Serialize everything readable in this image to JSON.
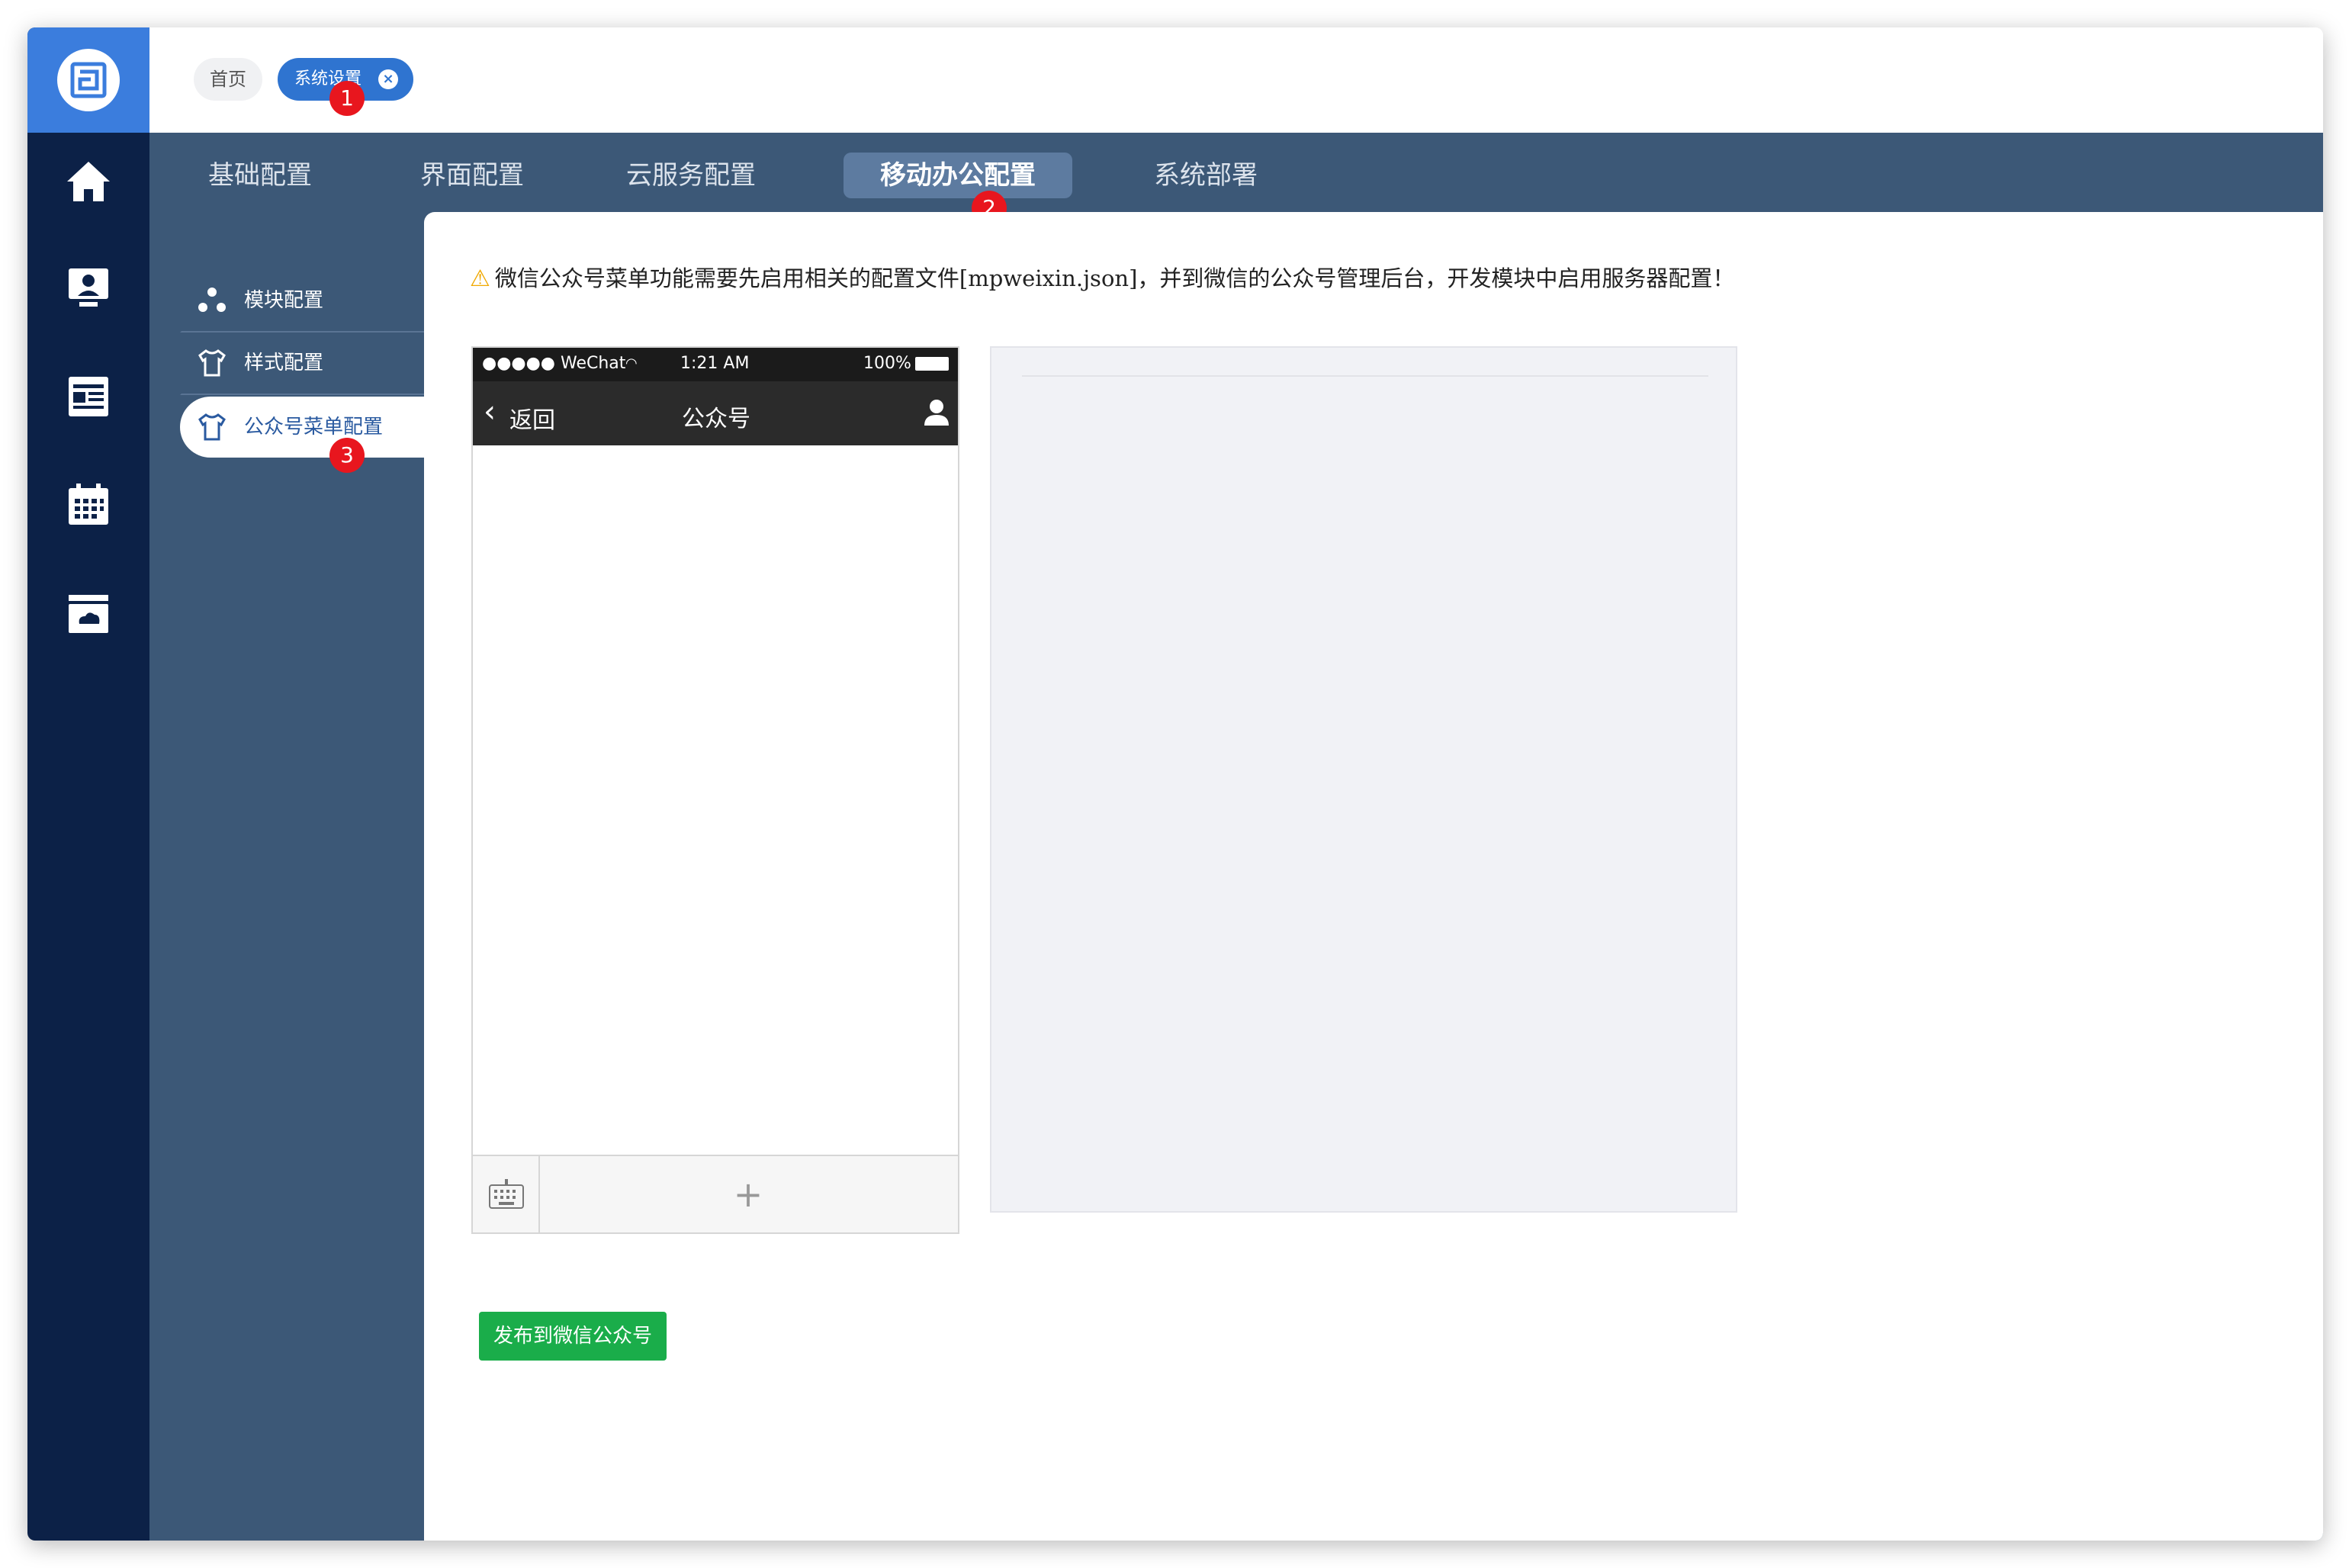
{
  "breadcrumb": {
    "home": "首页",
    "active": "系统设置",
    "close_icon": "close-circle-icon"
  },
  "badges": [
    "1",
    "2",
    "3"
  ],
  "rail_icons": [
    "app-logo-icon",
    "home-icon",
    "user-monitor-icon",
    "news-icon",
    "calendar-icon",
    "cloud-folder-icon"
  ],
  "tabs": [
    {
      "label": "基础配置",
      "active": false
    },
    {
      "label": "界面配置",
      "active": false
    },
    {
      "label": "云服务配置",
      "active": false
    },
    {
      "label": "移动办公配置",
      "active": true
    },
    {
      "label": "系统部署",
      "active": false
    }
  ],
  "menu": [
    {
      "label": "模块配置",
      "icon": "modules-icon",
      "active": false
    },
    {
      "label": "样式配置",
      "icon": "shirt-icon",
      "active": false
    },
    {
      "label": "公众号菜单配置",
      "icon": "shirt-icon",
      "active": true
    }
  ],
  "notice": {
    "text": "微信公众号菜单功能需要先启用相关的配置文件[mpweixin.json]，并到微信的公众号管理后台，开发模块中启用服务器配置！",
    "icon": "warning-icon"
  },
  "phone": {
    "carrier": "●●●●● WeChat",
    "time": "1:21 AM",
    "battery": "100%",
    "back": "返回",
    "title": "公众号",
    "add": "+"
  },
  "publish_button": "发布到微信公众号",
  "colors": {
    "rail": "#0c2147",
    "brand": "#3b7ddd",
    "submenu": "#3c5877",
    "publish": "#1aad4a",
    "badge": "#e8161e"
  }
}
